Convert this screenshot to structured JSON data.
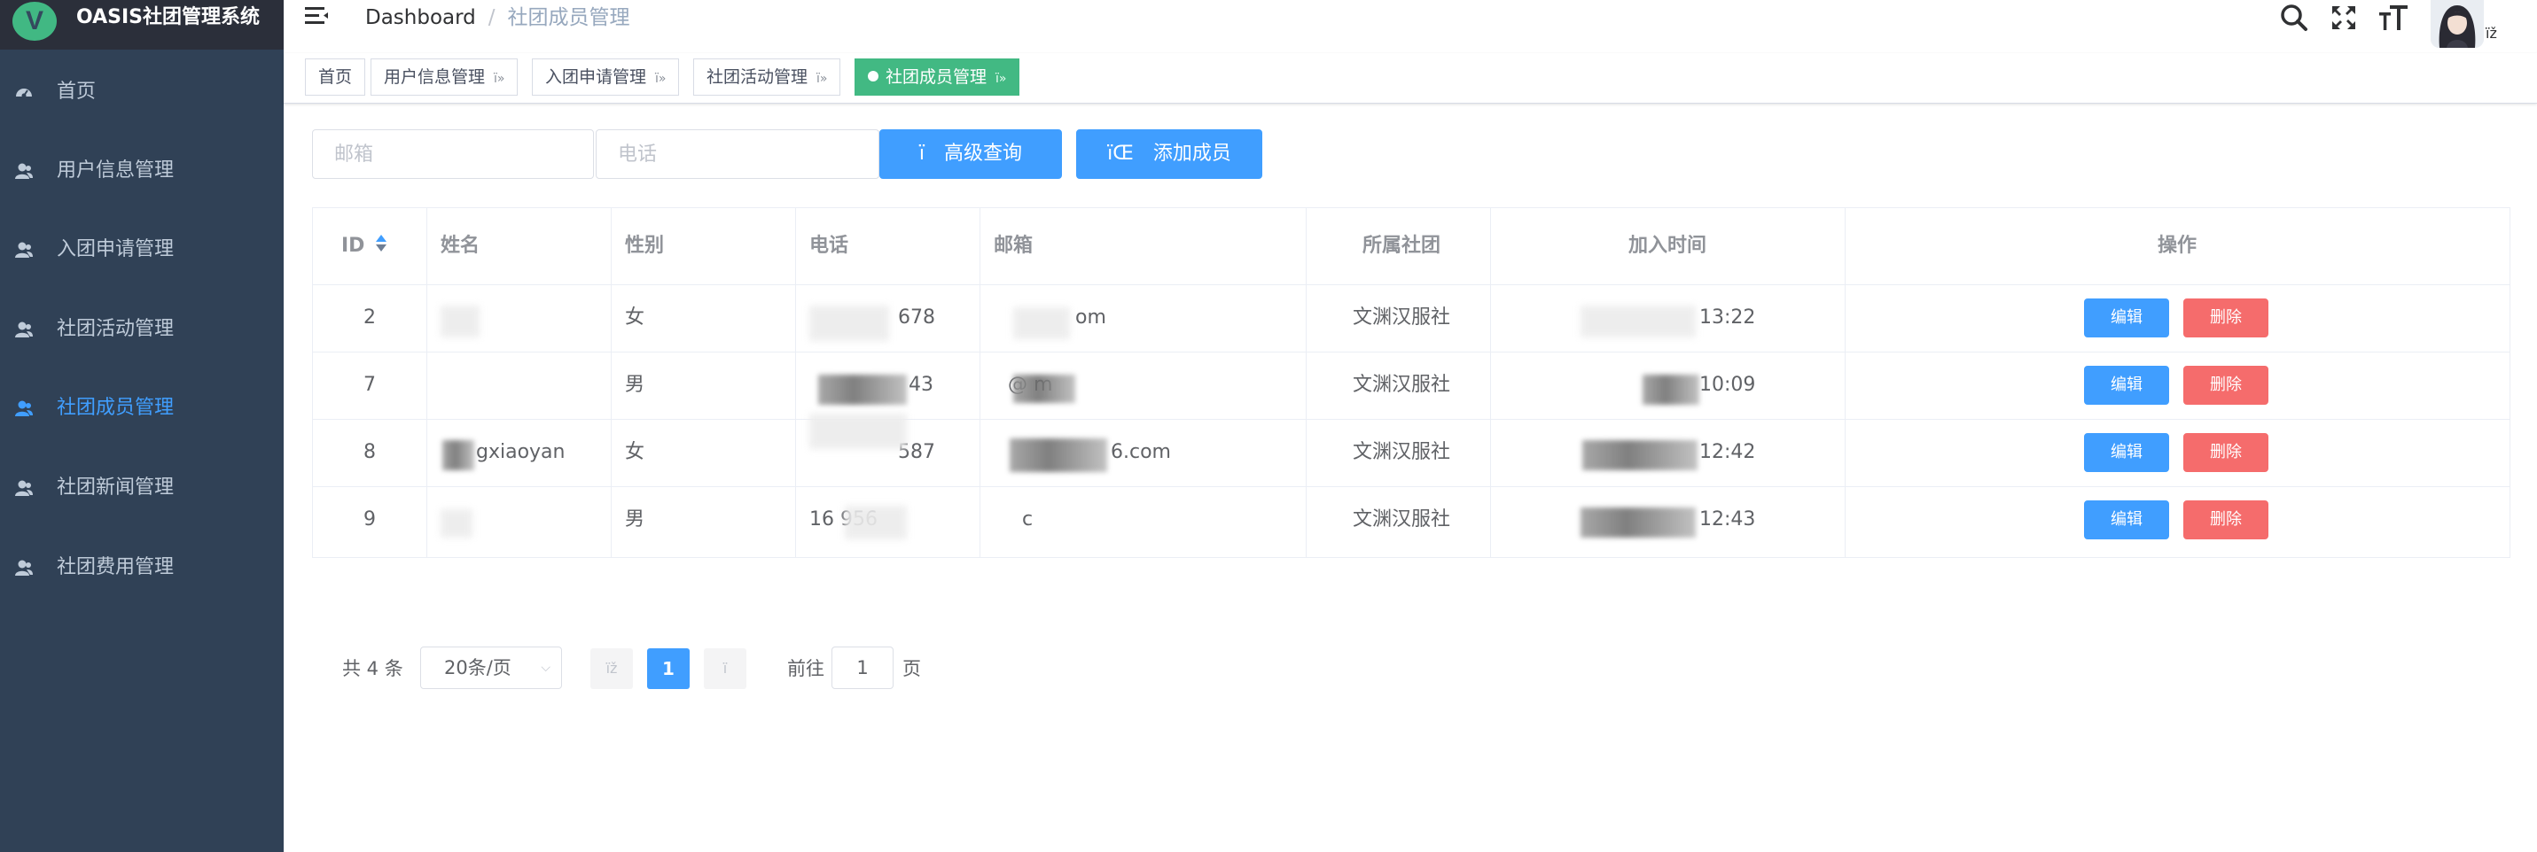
{
  "app": {
    "title": "OASIS社团管理系统",
    "logo_letter": "V"
  },
  "sidebar": {
    "items": [
      {
        "label": "首页",
        "icon": "dashboard-icon",
        "active": false
      },
      {
        "label": "用户信息管理",
        "icon": "user-icon",
        "active": false
      },
      {
        "label": "入团申请管理",
        "icon": "user-icon",
        "active": false
      },
      {
        "label": "社团活动管理",
        "icon": "user-icon",
        "active": false
      },
      {
        "label": "社团成员管理",
        "icon": "user-icon",
        "active": true
      },
      {
        "label": "社团新闻管理",
        "icon": "user-icon",
        "active": false
      },
      {
        "label": "社团费用管理",
        "icon": "user-icon",
        "active": false
      }
    ]
  },
  "navbar": {
    "breadcrumb_home": "Dashboard",
    "breadcrumb_sep": "/",
    "breadcrumb_current": "社团成员管理",
    "avatar_caret": "ïž"
  },
  "tags": [
    {
      "label": "首页",
      "close": "",
      "active": false
    },
    {
      "label": "用户信息管理",
      "close": "ï»",
      "active": false
    },
    {
      "label": "入团申请管理",
      "close": "ï»",
      "active": false
    },
    {
      "label": "社团活动管理",
      "close": "ï»",
      "active": false
    },
    {
      "label": "社团成员管理",
      "close": "ï»",
      "active": true
    }
  ],
  "filter": {
    "email_placeholder": "邮箱",
    "phone_placeholder": "电话",
    "search_button_icon": "ï",
    "search_button_label": "高级查询",
    "add_button_icon": "ïŒ",
    "add_button_label": "添加成员"
  },
  "table": {
    "headers": {
      "id": "ID",
      "name": "姓名",
      "gender": "性别",
      "phone": "电话",
      "email": "邮箱",
      "club": "所属社团",
      "join_time": "加入时间",
      "actions": "操作"
    },
    "rows": [
      {
        "id": "2",
        "name": "",
        "gender": "女",
        "phone": "678",
        "email": "om",
        "club": "文渊汉服社",
        "join_time": "13:22"
      },
      {
        "id": "7",
        "name": "",
        "gender": "男",
        "phone": "43",
        "email": "@   m",
        "club": "文渊汉服社",
        "join_time": "10:09"
      },
      {
        "id": "8",
        "name": "gxiaoyan",
        "gender": "女",
        "phone": "587",
        "email": "6.com",
        "club": "文渊汉服社",
        "join_time": "12:42"
      },
      {
        "id": "9",
        "name": "",
        "gender": "男",
        "phone": "16      956",
        "email": "c",
        "club": "文渊汉服社",
        "join_time": "12:43"
      }
    ],
    "edit_label": "编辑",
    "delete_label": "删除"
  },
  "pagination": {
    "total_text": "共 4 条",
    "page_size": "20条/页",
    "prev": "ïž",
    "next": "ï",
    "current_page": "1",
    "goto_label": "前往",
    "goto_value": "1",
    "page_suffix": "页"
  },
  "colors": {
    "sidebar_bg": "#304156",
    "logo_bar_bg": "#2b2f3a",
    "accent": "#409eff",
    "tag_active": "#42b983",
    "danger": "#f56c6c"
  }
}
